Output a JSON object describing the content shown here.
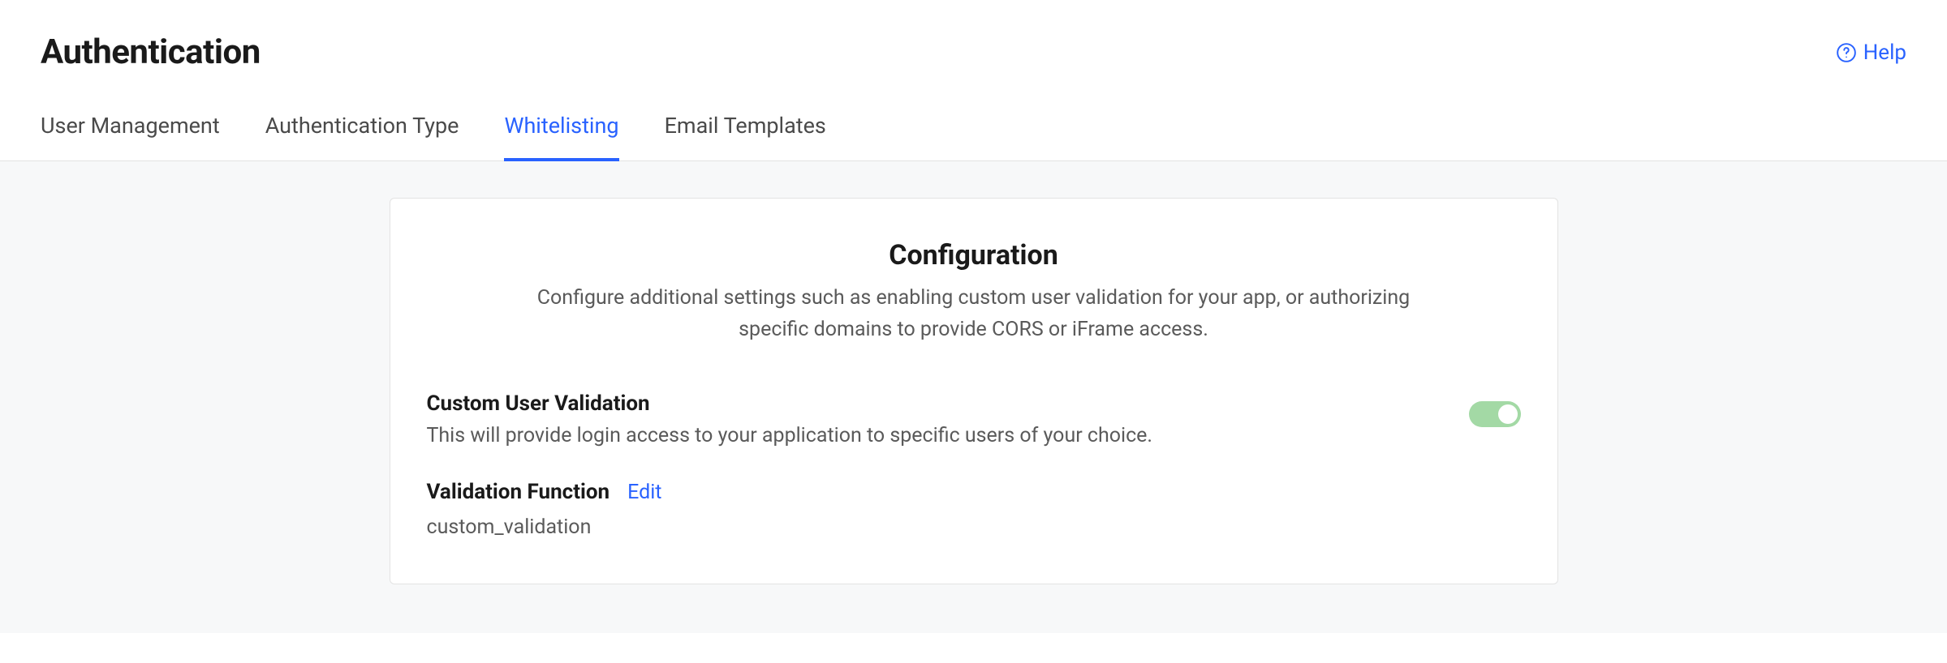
{
  "header": {
    "title": "Authentication",
    "help_label": "Help"
  },
  "tabs": [
    {
      "label": "User Management",
      "active": false
    },
    {
      "label": "Authentication Type",
      "active": false
    },
    {
      "label": "Whitelisting",
      "active": true
    },
    {
      "label": "Email Templates",
      "active": false
    }
  ],
  "card": {
    "title": "Configuration",
    "subtitle": "Configure additional settings such as enabling custom user validation for your app, or authorizing specific domains to provide CORS or iFrame access.",
    "custom_validation": {
      "heading": "Custom User Validation",
      "description": "This will provide login access to your application to specific users of your choice.",
      "enabled": true
    },
    "validation_function": {
      "label": "Validation Function",
      "edit_label": "Edit",
      "value": "custom_validation"
    }
  }
}
